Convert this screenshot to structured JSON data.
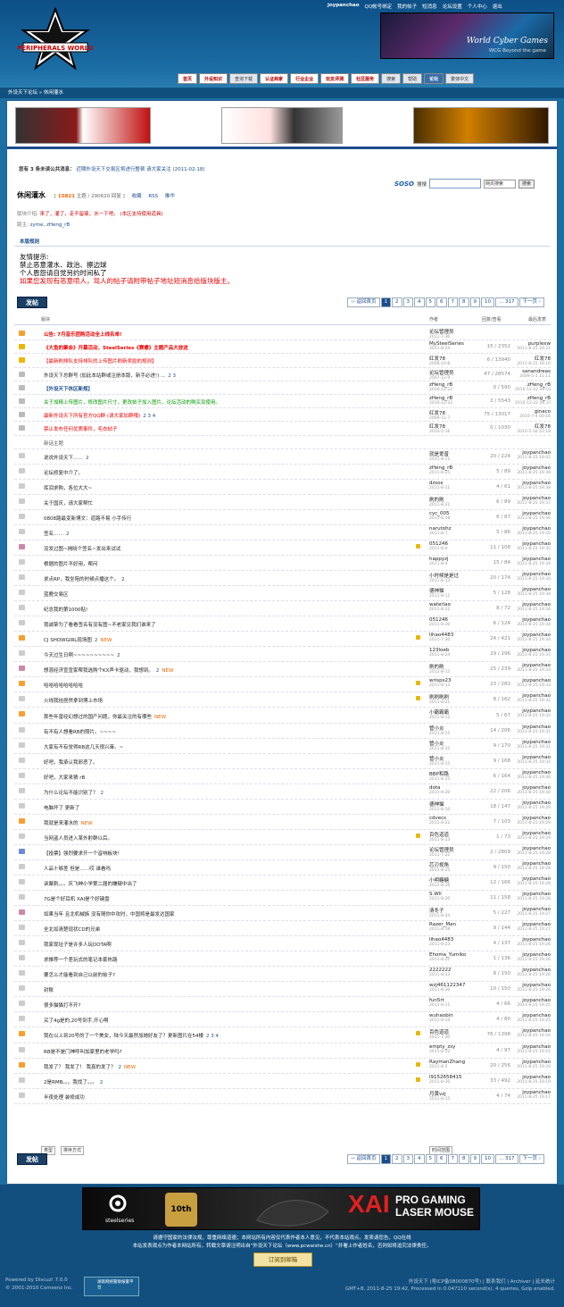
{
  "header": {
    "logo_text": "PERIPHERALS WORLD",
    "user": {
      "name": "joypanchao",
      "qq_bind": "QQ帐号绑定",
      "my_posts": "我的帖子",
      "messages": "短消息",
      "forum_settings": "论坛设置",
      "control_panel": "个人中心",
      "logout": "退出"
    },
    "banner": {
      "title": "World Cyber Games",
      "subtitle": "WCG Beyond the game"
    },
    "nav": [
      "首页",
      "外设知识",
      "查询下载",
      "认证商家",
      "行业企业",
      "玩友评测",
      "社区服务",
      "搜索",
      "帮助",
      "论坛",
      "繁体中文"
    ]
  },
  "breadcrumb": "外设天下论坛 » 休闲灌水",
  "notice": {
    "label": "您有 3 条未读公共消息：",
    "text": "近期外设天下交易区将进行整顿 请大家关注 (2011-02-18)"
  },
  "forum": {
    "title": "休闲灌水",
    "topics": "15821",
    "stat_text": "主题 / 290620 回复",
    "favorite": "收藏",
    "rss": "RSS",
    "donate": "推华",
    "intro_label": "版块介绍:",
    "intro_text": "来了，灌了，走不留痕，水一下吧。 (本区支持使用道具)",
    "mods_label": "版主:",
    "mods": "zyme, zHeng_rB"
  },
  "search": {
    "soso": "SOSO",
    "label": "搜搜",
    "select": "网页搜索",
    "button": "搜索"
  },
  "rules": {
    "heading": "本版规则",
    "lines": [
      "友情提示:",
      "禁止恶意灌水、政治、擦边球",
      "个人恩怨请自觉另约时间私了"
    ],
    "red": "如果您发现有恶意喷人，骂人的帖子请附带帖子地址短消息给版块版主。"
  },
  "post_button": "发帖",
  "pager": {
    "back": "‹‹ 返回首页",
    "pages": [
      "1",
      "2",
      "3",
      "4",
      "5",
      "6",
      "7",
      "8",
      "9",
      "10",
      "... 317"
    ],
    "next": "下一页 ›"
  },
  "table_header": {
    "title": "版块",
    "author": "作者",
    "replies": "回复/查看",
    "last": "最后发表"
  },
  "rows": [
    {
      "icon": "#f7a030",
      "t": "公告: 7月音乐团购活动全上线名单!",
      "c": "red bold",
      "a": "论坛管理员",
      "ad": "2011-7-30",
      "rv": "",
      "lp": "",
      "ld": ""
    },
    {
      "icon": "#e8b800",
      "t": "《大鱼的聚会》开幕活动，SteelSeries《赛睿》主题产品大放送",
      "c": "red bold",
      "a": "MySteelSeries",
      "ad": "2011-8-24",
      "rv": "15 / 2352",
      "lp": "purplexw",
      "ld": "2011-8-25 19:21"
    },
    {
      "icon": "#e8b800",
      "t": "【最新刷排队支持排队的上传图片刷新奖励的规则】",
      "c": "red",
      "a": "红发78",
      "ad": "2008-10-8",
      "rv": "6 / 13940",
      "lp": "红发78",
      "ld": "2011-8-25 18:10"
    },
    {
      "icon": "#bbb",
      "t": "外设天下总群号 (加此本站群或注册本版，新手必进!) ...",
      "pg": "2 3",
      "c": "",
      "a": "论坛管理员",
      "ad": "2007-12-9",
      "rv": "47 / 28574",
      "lp": "sanandreas",
      "ld": "2009-5-1 11:11"
    },
    {
      "icon": "#bbb",
      "t": "【外设天下休区新规】",
      "c": "blu bold",
      "a": "zHeng_rB",
      "ad": "2010-12-22",
      "rv": "0 / 590",
      "lp": "zHeng_rB",
      "ld": "2010-12-22 09:01"
    },
    {
      "icon": "#bbb",
      "t": "关于加精上传图片，修改图片尺寸，更改帖子加入图片，论坛活动的购买及使用。",
      "c": "grn",
      "a": "zHeng_rB",
      "ad": "2010-12-22",
      "rv": "2 / 5543",
      "lp": "zHeng_rB",
      "ld": "2010-12-22 06:37"
    },
    {
      "icon": "#bbb",
      "t": "最新外设天下所有官方QQ群 (请大家加群哦)",
      "pg": "2 3 4",
      "c": "red",
      "a": "红发78",
      "ad": "2009-11-7",
      "rv": "75 / 13017",
      "lp": "ginaco",
      "ld": "2010-7-4 00:16"
    },
    {
      "icon": "#bbb",
      "t": "禁止发布任何优质事件，毛衣帖子",
      "c": "red",
      "a": "红发78",
      "ad": "2010-5-16",
      "rv": "0 / 1030",
      "lp": "红发78",
      "ld": "2010-5-16 22:18"
    },
    {
      "icon": "",
      "t": "新话主题",
      "c": "sep",
      "a": "",
      "ad": "",
      "rv": "",
      "lp": "",
      "ld": ""
    },
    {
      "icon": "#ccc",
      "t": "说说外设天下……",
      "pg": "2",
      "a": "就是爱普",
      "ad": "2011-8-11",
      "rv": "20 / 224",
      "lp": "joypanchao",
      "ld": "2011-8-25 19:42"
    },
    {
      "icon": "#ccc",
      "t": "论坛修复中介了。",
      "a": "zHeng_rB",
      "ad": "2011-8-25",
      "rv": "5 / 89",
      "lp": "joypanchao",
      "ld": "2011-8-25 19:39"
    },
    {
      "icon": "#ccc",
      "t": "挥泪求购，各位大大~",
      "a": "dzsos",
      "ad": "2011-8-11",
      "rv": "4 / 61",
      "lp": "joypanchao",
      "ld": "2011-8-25 19:38"
    },
    {
      "icon": "#ccc",
      "t": "关于国庆，请大家帮忙",
      "a": "刷的刷",
      "ad": "2011-8-21",
      "rv": "6 / 89",
      "lp": "joypanchao",
      "ld": "2011-8-25 19:37"
    },
    {
      "icon": "#ccc",
      "t": "0808路最变新博文：道路不易 小手传行",
      "a": "cyc_005",
      "ad": "2011-8-18",
      "rv": "6 / 87",
      "lp": "joypanchao",
      "ld": "2011-8-25 19:36"
    },
    {
      "icon": "#ccc",
      "t": "签名……",
      "pg": "2",
      "a": "narutohz",
      "ad": "2011-8-7",
      "rv": "5 / 86",
      "lp": "joypanchao",
      "ld": "2011-8-25 19:35"
    },
    {
      "icon": "#c8a",
      "t": "没发过图~揭晓个签名~发出来试试",
      "flag": 1,
      "a": "051246",
      "ad": "2011-8-9",
      "rv": "11 / 108",
      "lp": "joypanchao",
      "ld": "2011-8-25 19:35"
    },
    {
      "icon": "#ccc",
      "t": "根据的图片不好用，帮问",
      "a": "happyzj",
      "ad": "2011-8-4",
      "rv": "15 / 84",
      "lp": "joypanchao",
      "ld": "2011-8-25 19:34"
    },
    {
      "icon": "#ccc",
      "t": "求点RP，我坐陪的时候点播这个。",
      "pg": "2",
      "a": "小时候是是过",
      "ad": "2011-8-13",
      "rv": "20 / 174",
      "lp": "joypanchao",
      "ld": "2011-8-25 19:34"
    },
    {
      "icon": "#ccc",
      "t": "蓝鹿交易区",
      "a": "德神猫",
      "ad": "2011-8-11",
      "rv": "5 / 128",
      "lp": "joypanchao",
      "ld": "2011-8-25 19:34"
    },
    {
      "icon": "#ccc",
      "t": "纪念我的第1000贴!",
      "a": "waterlao",
      "ad": "2011-8-22",
      "rv": "8 / 72",
      "lp": "joypanchao",
      "ld": "2011-8-25 19:34"
    },
    {
      "icon": "#ccc",
      "t": "我诚挚为了看看签名有没有图~不老家见我们谁来了",
      "a": "051246",
      "ad": "2011-8-20",
      "rv": "6 / 124",
      "lp": "joypanchao",
      "ld": "2011-8-25 19:34"
    },
    {
      "icon": "#f7a030",
      "t": "CJ SHOWGIRL现场图",
      "flag": 1,
      "pg": "2",
      "nw": "NEW",
      "a": "lihao4483",
      "ad": "2011-7-30",
      "rv": "24 / 421",
      "lp": "joypanchao",
      "ld": "2011-8-25 19:34"
    },
    {
      "icon": "#ccc",
      "t": "今天过生日啊~~~~~~~~~~",
      "pg": "2",
      "a": "123loeb",
      "ad": "2011-8-24",
      "rv": "29 / 196",
      "lp": "joypanchao",
      "ld": "2011-8-25 19:33"
    },
    {
      "icon": "#c8a",
      "t": "想混经济宣宣家帮我选购个KX声卡驱动，我想到。",
      "pg": "2",
      "nw": "NEW",
      "a": "刷的刷",
      "ad": "2011-8-15",
      "rv": "25 / 239",
      "lp": "joypanchao",
      "ld": "2011-8-25 19:33"
    },
    {
      "icon": "#f7a030",
      "t": "哈哈哈哈哈哈哈哈",
      "flag": 1,
      "a": "wrisps23",
      "ad": "2011-8-13",
      "rv": "23 / 283",
      "lp": "joypanchao",
      "ld": "2011-8-25 19:33"
    },
    {
      "icon": "#ccc",
      "t": "火线我挂居然拿到博上市场",
      "flag": 1,
      "a": "刷刷刷刷",
      "ad": "2011-8-21",
      "rv": "8 / 162",
      "lp": "joypanchao",
      "ld": "2011-8-25 19:32"
    },
    {
      "icon": "#f7a030",
      "t": "那些年曾经幻想过的国产问题，你最关注的有哪些",
      "nw": "NEW",
      "a": "小霸霸霸",
      "ad": "2011-8-12",
      "rv": "5 / 67",
      "lp": "joypanchao",
      "ld": "2011-8-25 19:32"
    },
    {
      "icon": "#ccc",
      "t": "有不有人想看RB的照片。~~~~",
      "a": "管小炎",
      "ad": "2011-8-15",
      "rv": "14 / 206",
      "lp": "joypanchao",
      "ld": "2011-8-25 19:31"
    },
    {
      "icon": "#ccc",
      "t": "大家有不有觉得RB这几天很兴奋。~",
      "a": "管小炎",
      "ad": "2011-8-15",
      "rv": "9 / 170",
      "lp": "joypanchao",
      "ld": "2011-8-25 19:31"
    },
    {
      "icon": "#ccc",
      "t": "好吧，我承认我邪恶了。",
      "a": "管小炎",
      "ad": "2011-8-15",
      "rv": "9 / 168",
      "lp": "joypanchao",
      "ld": "2011-8-25 19:31"
    },
    {
      "icon": "#ccc",
      "t": "好吧，大家来猜 rB",
      "a": "BBP和路",
      "ad": "2011-8-15",
      "rv": "6 / 164",
      "lp": "joypanchao",
      "ld": "2011-8-25 19:30"
    },
    {
      "icon": "#ccc",
      "t": "为什么论坛不能识别了？",
      "pg": "2",
      "a": "dota",
      "ad": "2011-8-20",
      "rv": "22 / 206",
      "lp": "joypanchao",
      "ld": "2011-8-25 19:30"
    },
    {
      "icon": "#ccc",
      "t": "电脑坏了 更新了",
      "a": "德神猫",
      "ad": "2011-8-10",
      "rv": "18 / 147",
      "lp": "joypanchao",
      "ld": "2011-8-25 19:29"
    },
    {
      "icon": "#f7a030",
      "t": "我就是来灌水的",
      "nw": "NEW",
      "a": "cdvecs",
      "ad": "2011-8-22",
      "rv": "7 / 103",
      "lp": "joypanchao",
      "ld": "2011-8-25 19:29"
    },
    {
      "icon": "#ccc",
      "t": "当网盗人员进入某外射群以后。",
      "flag": 1,
      "a": "百色道道",
      "ad": "2011-8-23",
      "rv": "1 / 73",
      "lp": "joypanchao",
      "ld": "2011-8-25 19:29"
    },
    {
      "icon": "#6a8ad8",
      "t": "【投票】强烈要求开一个音响板块!",
      "a": "论坛管理员",
      "ad": "2011-7-22",
      "rv": "2 / 2809",
      "lp": "joypanchao",
      "ld": "2011-8-25 19:28"
    },
    {
      "icon": "#ccc",
      "t": "人品十够差 但是……哎 谁看吗",
      "a": "芯刃视角",
      "ad": "2011-8-25",
      "rv": "9 / 150",
      "lp": "joypanchao",
      "ld": "2011-8-25 19:28"
    },
    {
      "icon": "#ccc",
      "t": "讽聚刺。。。庆飞绅小学第二届的嫌疑中出了",
      "a": "小明糖糖",
      "ad": "2011-8-16",
      "rv": "12 / 166",
      "lp": "joypanchao",
      "ld": "2011-8-25 19:28"
    },
    {
      "icon": "#ccc",
      "t": "7G是个好耳机 XAI是个好键盘",
      "a": "S.Wll",
      "ad": "2011-8-20",
      "rv": "11 / 158",
      "lp": "joypanchao",
      "ld": "2011-8-25 19:28"
    },
    {
      "icon": "#c8a",
      "t": "如果当年 且北机械族 没有随你中攻时，中国将是最发达国家",
      "a": "清冬子",
      "ad": "2011-8-24",
      "rv": "5 / 227",
      "lp": "joypanchao",
      "ld": "2011-8-25 19:27"
    },
    {
      "icon": "#ccc",
      "t": "全北如清楚现状CD的兄弟",
      "a": "Razer_Man",
      "ad": "2011-8-18",
      "rv": "9 / 144",
      "lp": "joypanchao",
      "ld": "2011-8-25 19:27"
    },
    {
      "icon": "#ccc",
      "t": "我家现址子是许多人玩DOTA啊",
      "a": "lihao4483",
      "ad": "2011-8-23",
      "rv": "4 / 137",
      "lp": "joypanchao",
      "ld": "2011-8-25 19:26"
    },
    {
      "icon": "#ccc",
      "t": "求推荐一个差玩式的笔记本套热路",
      "a": "Ehoma_Yumiko",
      "ad": "2011-8-22",
      "rv": "1 / 136",
      "lp": "joypanchao",
      "ld": "2011-8-25 19:26"
    },
    {
      "icon": "#ccc",
      "t": "要怎么才能看到自己以前的帖子?",
      "a": "2222222",
      "ad": "2011-8-13",
      "rv": "8 / 150",
      "lp": "joypanchao",
      "ld": "2011-8-25 19:26"
    },
    {
      "icon": "#ccc",
      "t": "封账",
      "a": "wzj461122347",
      "ad": "2011-8-20",
      "rv": "10 / 150",
      "lp": "joypanchao",
      "ld": "2011-8-25 19:26"
    },
    {
      "icon": "#ccc",
      "t": "很多猫猫打不开?",
      "a": "fun5rt",
      "ad": "2011-8-11",
      "rv": "4 / 66",
      "lp": "joypanchao",
      "ld": "2011-8-25 19:25"
    },
    {
      "icon": "#ccc",
      "t": "买了4g是的,20号到手,开心啊",
      "a": "wuhaobin",
      "ad": "2011-8-14",
      "rv": "4 / 80",
      "lp": "joypanchao",
      "ld": "2011-8-25 19:25"
    },
    {
      "icon": "#f7a030",
      "t": "我在以上到20号的了一个美女，陆今天最然加她好友了？更新图片在54楼",
      "flag": 1,
      "pg": "2 3 4",
      "a": "百色道道",
      "ad": "2011-7-30",
      "rv": "76 / 1398",
      "lp": "joypanchao",
      "ld": "2011-8-25 19:24"
    },
    {
      "icon": "#ccc",
      "t": "RB是不是门神呼叫加家里的老学吗?",
      "a": "empty_zsy",
      "ad": "2011-8-12",
      "rv": "4 / 97",
      "lp": "joypanchao",
      "ld": "2011-8-25 19:21"
    },
    {
      "icon": "#f7a030",
      "t": "我发了？ 我发了！ 我真的发了？",
      "flag": 1,
      "pg": "2",
      "nw": "NEW",
      "a": "RaymanZhang",
      "ad": "2011-8-5",
      "rv": "20 / 256",
      "lp": "joypanchao",
      "ld": "2011-8-25 19:20"
    },
    {
      "icon": "#ccc",
      "t": "2是RMB。。。我找了。。。",
      "pg": "2",
      "flag": 1,
      "a": "l9152658415",
      "ad": "2011-8-20",
      "rv": "33 / 492",
      "lp": "joypanchao",
      "ld": "2011-8-25 19:19"
    },
    {
      "icon": "#ccc",
      "t": "半夜处理 装修成功",
      "a": "月黄vzj",
      "ad": "2011-8-15",
      "rv": "4 / 74",
      "lp": "joypanchao",
      "ld": "2011-8-25 19:17"
    }
  ],
  "bottom_filters": {
    "type": "类型",
    "sort": "排序方式",
    "time": "时间范围"
  },
  "footer": {
    "ad_brand": "steelseries",
    "ad_10th": "10th",
    "ad_xai": "XAI",
    "ad_line1": "PRO GAMING",
    "ad_line2": "LASER MOUSE",
    "line1": "请遵守国家的法律法规，尊重网络道德；本网站所有内容仅代表作者本人意见，不代表本站观点。发表请您告，QQ在线",
    "line2": "本站发表观点为作者本网站所有，转载文章请注明出自”外设天下论坛（www.pcwaishe.cn）“并署上作者姓名，否则如将追究法律责任。",
    "subscribe": "订阅到邮箱",
    "powered": "Powered by Discuz! 7.0.0",
    "copyright": "© 2001-2010 Comsenz Inc.",
    "cert": "湖南网络警察报警平台",
    "right1": "外设天下 (粤ICP备08000870号) | 联系我们 | Archiver | 延长统计",
    "right2": "GMT+8, 2011-8-25 19:42, Processed in 0.047110 second(s), 4 queries, Gzip enabled."
  }
}
